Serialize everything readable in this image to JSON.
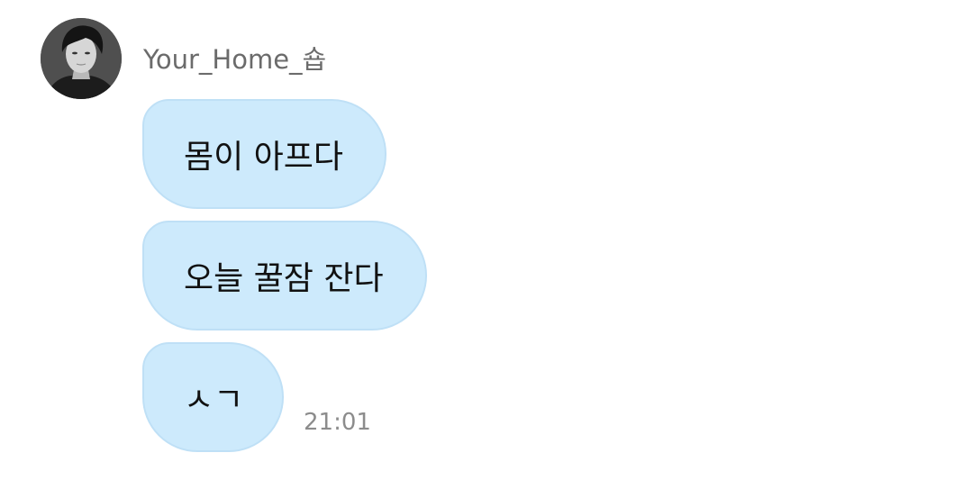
{
  "chat": {
    "sender": {
      "name": "Your_Home_숍",
      "avatar_icon": "profile-photo"
    },
    "messages": [
      {
        "text": "몸이 아프다"
      },
      {
        "text": "오늘 꿀잠 잔다"
      },
      {
        "text": "ㅅㄱ"
      }
    ],
    "timestamp": "21:01"
  },
  "colors": {
    "bubble_background": "#cdeafc",
    "bubble_border": "#bfe0f6",
    "sender_name": "#6b6b6b",
    "timestamp": "#8c8c8c"
  }
}
